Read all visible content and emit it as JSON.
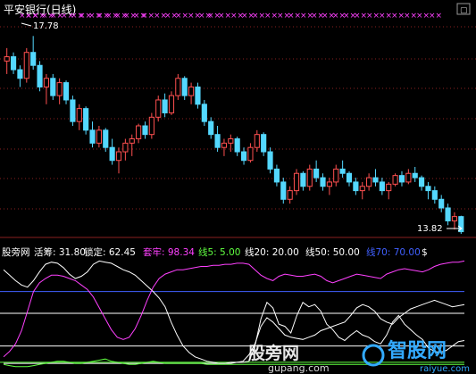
{
  "colors": {
    "background": "#000000",
    "up": "#ff5050",
    "down": "#54d8ff",
    "grid": "#8a2020",
    "marker": "#ff40ff",
    "title": "#ffffff",
    "label": "#ffffff",
    "white_line": "#ffffff",
    "magenta_line": "#e040e0",
    "blue_line": "#4060ff",
    "green_line": "#60ff40"
  },
  "chart_data": [
    {
      "type": "candlestick",
      "title": "平安银行(日线)",
      "ylim": [
        13.2,
        18.2
      ],
      "grid": true,
      "max_label": "17.78",
      "min_label": "13.82",
      "marker_symbol": "×",
      "marker_slots": [
        21,
        28,
        36,
        46,
        56,
        68,
        79,
        88,
        99,
        108,
        118,
        128,
        138,
        149,
        158,
        172,
        184,
        196,
        210,
        222,
        232,
        244,
        258,
        270,
        282,
        296,
        310,
        322,
        336,
        348,
        360,
        372,
        384,
        396,
        410,
        424,
        438,
        452,
        466,
        480
      ],
      "candles": [
        [
          17.2,
          17.5,
          16.9,
          17.3
        ],
        [
          17.3,
          17.4,
          16.9,
          17.0
        ],
        [
          17.0,
          17.1,
          16.6,
          16.8
        ],
        [
          16.8,
          17.5,
          16.7,
          17.4
        ],
        [
          17.4,
          17.78,
          17.0,
          17.1
        ],
        [
          17.1,
          17.2,
          16.5,
          16.6
        ],
        [
          16.6,
          16.9,
          16.2,
          16.8
        ],
        [
          16.8,
          16.9,
          16.3,
          16.4
        ],
        [
          16.4,
          16.8,
          16.2,
          16.7
        ],
        [
          16.7,
          16.75,
          16.2,
          16.3
        ],
        [
          16.3,
          16.4,
          15.7,
          15.8
        ],
        [
          15.8,
          16.2,
          15.6,
          16.1
        ],
        [
          16.1,
          16.15,
          15.5,
          15.6
        ],
        [
          15.6,
          15.8,
          15.2,
          15.3
        ],
        [
          15.3,
          15.7,
          15.2,
          15.6
        ],
        [
          15.6,
          15.65,
          15.1,
          15.2
        ],
        [
          15.2,
          15.4,
          14.8,
          14.9
        ],
        [
          14.9,
          15.2,
          14.6,
          15.1
        ],
        [
          15.1,
          15.4,
          14.9,
          15.3
        ],
        [
          15.3,
          15.5,
          15.0,
          15.4
        ],
        [
          15.4,
          15.75,
          15.3,
          15.7
        ],
        [
          15.7,
          15.8,
          15.4,
          15.5
        ],
        [
          15.5,
          16.0,
          15.4,
          15.9
        ],
        [
          15.9,
          16.4,
          15.8,
          16.3
        ],
        [
          16.3,
          16.45,
          15.9,
          16.0
        ],
        [
          16.0,
          16.5,
          15.95,
          16.4
        ],
        [
          16.4,
          16.9,
          16.3,
          16.8
        ],
        [
          16.8,
          16.85,
          16.3,
          16.4
        ],
        [
          16.4,
          16.7,
          16.2,
          16.6
        ],
        [
          16.6,
          16.7,
          16.1,
          16.2
        ],
        [
          16.2,
          16.3,
          15.7,
          15.8
        ],
        [
          15.8,
          15.9,
          15.4,
          15.5
        ],
        [
          15.5,
          15.7,
          15.1,
          15.2
        ],
        [
          15.2,
          15.4,
          15.0,
          15.3
        ],
        [
          15.3,
          15.5,
          15.1,
          15.4
        ],
        [
          15.4,
          15.45,
          15.0,
          15.1
        ],
        [
          15.1,
          15.2,
          14.8,
          14.9
        ],
        [
          14.9,
          15.3,
          14.85,
          15.2
        ],
        [
          15.2,
          15.6,
          15.1,
          15.5
        ],
        [
          15.5,
          15.55,
          15.0,
          15.1
        ],
        [
          15.1,
          15.2,
          14.6,
          14.7
        ],
        [
          14.7,
          14.8,
          14.3,
          14.4
        ],
        [
          14.4,
          14.5,
          13.9,
          14.0
        ],
        [
          14.0,
          14.3,
          13.9,
          14.2
        ],
        [
          14.2,
          14.7,
          14.1,
          14.6
        ],
        [
          14.6,
          14.65,
          14.2,
          14.3
        ],
        [
          14.3,
          14.8,
          14.2,
          14.7
        ],
        [
          14.7,
          14.9,
          14.4,
          14.5
        ],
        [
          14.5,
          14.6,
          14.2,
          14.3
        ],
        [
          14.3,
          14.5,
          14.1,
          14.4
        ],
        [
          14.4,
          14.8,
          14.3,
          14.7
        ],
        [
          14.7,
          14.9,
          14.5,
          14.6
        ],
        [
          14.6,
          14.65,
          14.3,
          14.4
        ],
        [
          14.4,
          14.5,
          14.1,
          14.2
        ],
        [
          14.2,
          14.4,
          14.0,
          14.3
        ],
        [
          14.3,
          14.6,
          14.2,
          14.5
        ],
        [
          14.5,
          14.7,
          14.3,
          14.4
        ],
        [
          14.4,
          14.5,
          14.1,
          14.2
        ],
        [
          14.2,
          14.4,
          14.0,
          14.35
        ],
        [
          14.35,
          14.6,
          14.3,
          14.55
        ],
        [
          14.55,
          14.65,
          14.3,
          14.4
        ],
        [
          14.4,
          14.7,
          14.35,
          14.6
        ],
        [
          14.6,
          14.75,
          14.4,
          14.5
        ],
        [
          14.5,
          14.55,
          14.2,
          14.3
        ],
        [
          14.3,
          14.4,
          14.0,
          14.2
        ],
        [
          14.2,
          14.3,
          13.9,
          14.0
        ],
        [
          14.0,
          14.1,
          13.7,
          13.8
        ],
        [
          13.8,
          13.9,
          13.4,
          13.5
        ],
        [
          13.5,
          13.7,
          13.3,
          13.6
        ],
        [
          13.6,
          13.62,
          13.2,
          13.25
        ]
      ]
    },
    {
      "type": "line",
      "ylim": [
        0,
        100
      ],
      "grid": true,
      "labels": [
        {
          "text": "股旁网",
          "color": "#ffffff"
        },
        {
          "text": "活筹: 31.80",
          "color": "#ffffff"
        },
        {
          "text": "锁定: 62.45",
          "color": "#ffffff"
        },
        {
          "text": "套牢: 98.34",
          "color": "#ff40ff"
        },
        {
          "text": "线5: 5.00",
          "color": "#60ff40"
        },
        {
          "text": "线20: 20.00",
          "color": "#ffffff"
        },
        {
          "text": "线50: 50.00",
          "color": "#ffffff"
        },
        {
          "text": "线70: 70.00",
          "color": "#4060ff"
        },
        {
          "text": "$",
          "color": "#ffffff"
        }
      ],
      "ref_lines": [
        {
          "value": 70,
          "color": "#4060ff"
        },
        {
          "value": 50,
          "color": "#ffffff"
        },
        {
          "value": 20,
          "color": "#ffffff"
        },
        {
          "value": 5,
          "color": "#60ff40"
        }
      ],
      "series": [
        {
          "color": "#ffffff",
          "values": [
            90,
            85,
            80,
            76,
            74,
            80,
            88,
            95,
            97,
            96,
            92,
            86,
            82,
            84,
            88,
            95,
            98,
            97,
            96,
            93,
            90,
            88,
            85,
            80,
            75,
            70,
            64,
            56,
            42,
            30,
            20,
            14,
            10,
            8,
            6,
            5,
            4,
            4,
            4,
            5,
            5,
            6,
            20,
            45,
            60,
            55,
            40,
            38,
            32,
            48,
            60,
            56,
            58,
            52,
            40,
            35,
            28,
            25,
            30,
            34,
            30,
            28,
            24,
            22,
            30,
            42,
            48,
            40,
            35,
            30,
            26,
            18,
            15,
            14,
            16,
            20,
            24,
            25
          ]
        },
        {
          "color": "#ff40ff",
          "values": [
            10,
            15,
            22,
            34,
            52,
            70,
            78,
            82,
            85,
            85,
            84,
            82,
            80,
            76,
            72,
            65,
            55,
            45,
            35,
            28,
            26,
            28,
            36,
            48,
            62,
            74,
            82,
            86,
            88,
            90,
            90,
            91,
            92,
            93,
            93,
            94,
            94,
            95,
            95,
            96,
            96,
            95,
            90,
            85,
            82,
            80,
            84,
            86,
            85,
            84,
            84,
            85,
            86,
            84,
            80,
            78,
            80,
            82,
            84,
            86,
            85,
            84,
            83,
            82,
            86,
            88,
            90,
            91,
            90,
            89,
            88,
            90,
            93,
            95,
            96,
            97,
            97,
            98
          ]
        },
        {
          "color": "#ffffff",
          "values": [
            4,
            4,
            4,
            4,
            4,
            4,
            4,
            4,
            4,
            4,
            4,
            4,
            4,
            4,
            4,
            4,
            4,
            4,
            4,
            4,
            4,
            4,
            4,
            4,
            4,
            4,
            4,
            4,
            4,
            4,
            4,
            4,
            4,
            4,
            4,
            4,
            4,
            4,
            5,
            5,
            6,
            12,
            22,
            38,
            46,
            42,
            36,
            30,
            28,
            27,
            26,
            28,
            30,
            34,
            36,
            38,
            40,
            42,
            48,
            55,
            58,
            56,
            52,
            45,
            42,
            40,
            46,
            50,
            54,
            56,
            58,
            60,
            62,
            60,
            58,
            56,
            57,
            58
          ]
        },
        {
          "color": "#60ff40",
          "values": [
            3,
            2,
            1,
            1,
            1,
            2,
            3,
            4,
            5,
            6,
            6,
            5,
            4,
            4,
            5,
            6,
            7,
            8,
            6,
            5,
            4,
            3,
            3,
            4,
            5,
            6,
            5,
            4,
            4,
            4,
            4,
            4,
            4,
            4,
            3,
            3,
            3,
            3,
            3,
            3,
            3,
            3,
            3,
            3,
            3,
            3,
            3,
            3,
            3,
            3,
            3,
            3,
            3,
            3,
            3,
            3,
            3,
            3,
            3,
            3,
            3,
            3,
            3,
            3,
            3,
            3,
            3,
            3,
            3,
            3,
            3,
            3,
            3,
            3,
            3,
            3,
            3,
            3
          ]
        }
      ]
    }
  ],
  "watermark": {
    "text1": "股旁网",
    "text2": "gupang.com",
    "logo_text": "智股网",
    "logo_url": "raiyue.com"
  },
  "toolbar": {
    "corner_button": "▢"
  }
}
